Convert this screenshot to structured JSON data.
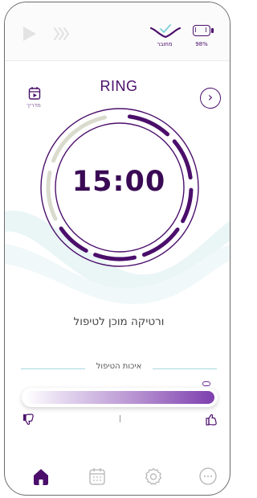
{
  "header": {
    "battery_percent": "98%",
    "connection_label": "מחובר",
    "icons": [
      "play-icon",
      "vibration-waves-icon",
      "connected-check-icon",
      "battery-icon"
    ]
  },
  "session": {
    "title": "RING",
    "guide_label": "מדריך",
    "timer": "15:00",
    "status": "ורטיקה מוכן לטיפול"
  },
  "quality": {
    "label": "איכות הטיפול",
    "level": 0.97
  },
  "nav": {
    "items": [
      "home",
      "calendar",
      "settings",
      "more"
    ],
    "active": "home"
  },
  "colors": {
    "accent": "#4b0f6b",
    "accent_light": "#7d3fae",
    "ring_inactive": "#d9dccd",
    "wave": "#e6f3f4",
    "divider": "#a8d8de"
  }
}
